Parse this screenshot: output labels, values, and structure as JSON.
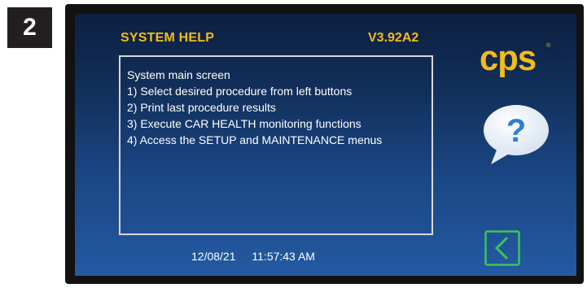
{
  "step": {
    "number": "2"
  },
  "header": {
    "title": "SYSTEM HELP",
    "version": "V3.92A2"
  },
  "help": {
    "lines": [
      "System main screen",
      "1) Select desired procedure from left buttons",
      "2) Print last procedure results",
      "3) Execute CAR HEALTH monitoring functions",
      "4) Access the SETUP and MAINTENANCE menus"
    ]
  },
  "brand": {
    "logo_text": "cps",
    "registered_mark": "®"
  },
  "help_icon": {
    "icon": "question-bubble-icon",
    "symbol": "?"
  },
  "back_button": {
    "icon": "chevron-left-icon"
  },
  "status": {
    "date": "12/08/21",
    "time": "11:57:43 AM"
  },
  "colors": {
    "accent_yellow": "#f3bb1c",
    "back_green": "#3fc25a",
    "help_bubble": "#ffffff",
    "help_symbol": "#2a7fd8"
  }
}
